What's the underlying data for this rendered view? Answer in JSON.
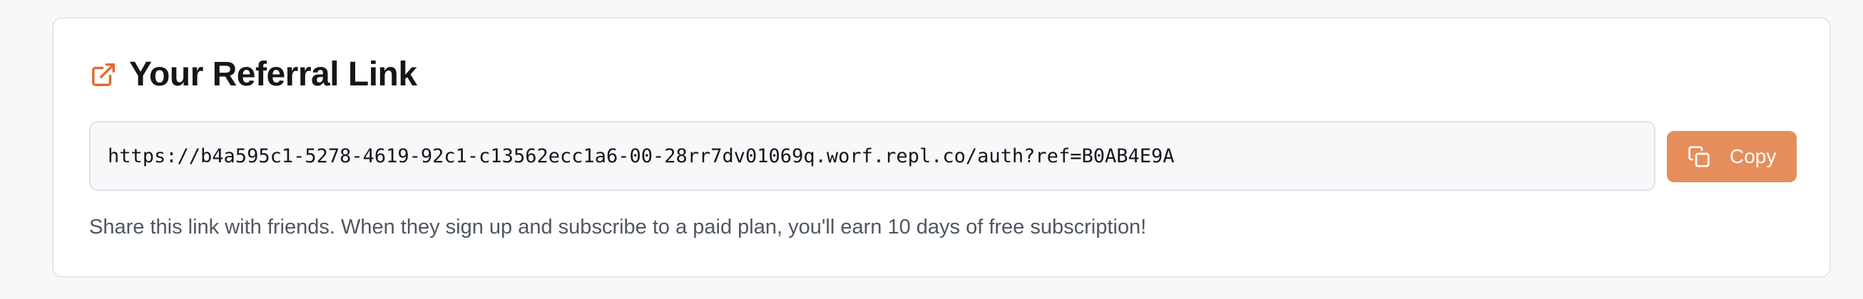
{
  "referral_card": {
    "title": "Your Referral Link",
    "title_icon": "external-link-icon",
    "link_value": "https://b4a595c1-5278-4619-92c1-c13562ecc1a6-00-28rr7dv01069q.worf.repl.co/auth?ref=B0AB4E9A",
    "copy_button": {
      "label": "Copy",
      "icon": "copy-icon"
    },
    "description": "Share this link with friends. When they sign up and subscribe to a paid plan, you'll earn 10 days of free subscription!"
  },
  "colors": {
    "accent": "#e58e5b",
    "icon_accent": "#e06b32",
    "page_background": "#f7f8fa",
    "card_background": "#ffffff",
    "text_primary": "#14161a",
    "text_secondary": "#4f5661"
  }
}
